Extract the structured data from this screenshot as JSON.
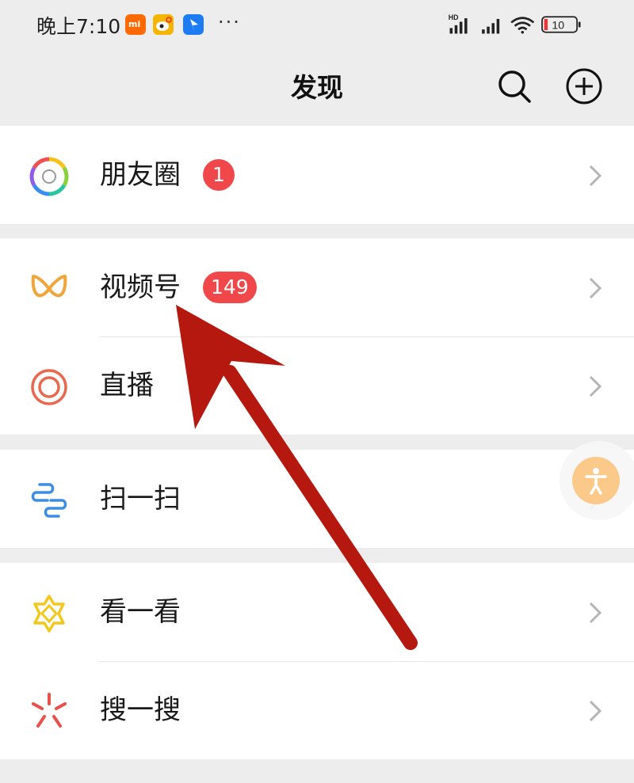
{
  "status_bar": {
    "time": "晚上7:10",
    "mi_label": "mi",
    "more_dots": "···",
    "network": "HD",
    "battery": "10"
  },
  "nav": {
    "title": "发现",
    "search_icon": "search-icon",
    "add_icon": "plus-circle-icon"
  },
  "groups": [
    {
      "items": [
        {
          "label": "朋友圈",
          "badge": "1",
          "icon": "moments-aperture-icon"
        }
      ]
    },
    {
      "items": [
        {
          "label": "视频号",
          "badge": "149",
          "icon": "channels-icon"
        },
        {
          "label": "直播",
          "icon": "live-icon"
        }
      ]
    },
    {
      "items": [
        {
          "label": "扫一扫",
          "icon": "scan-icon"
        }
      ]
    },
    {
      "items": [
        {
          "label": "看一看",
          "icon": "top-stories-icon"
        },
        {
          "label": "搜一搜",
          "icon": "search-sparkle-icon"
        }
      ]
    }
  ],
  "colors": {
    "background": "#ededed",
    "badge": "#f0474a",
    "annotation_arrow": "#b5180f",
    "floating_button": "#fbc98a"
  }
}
